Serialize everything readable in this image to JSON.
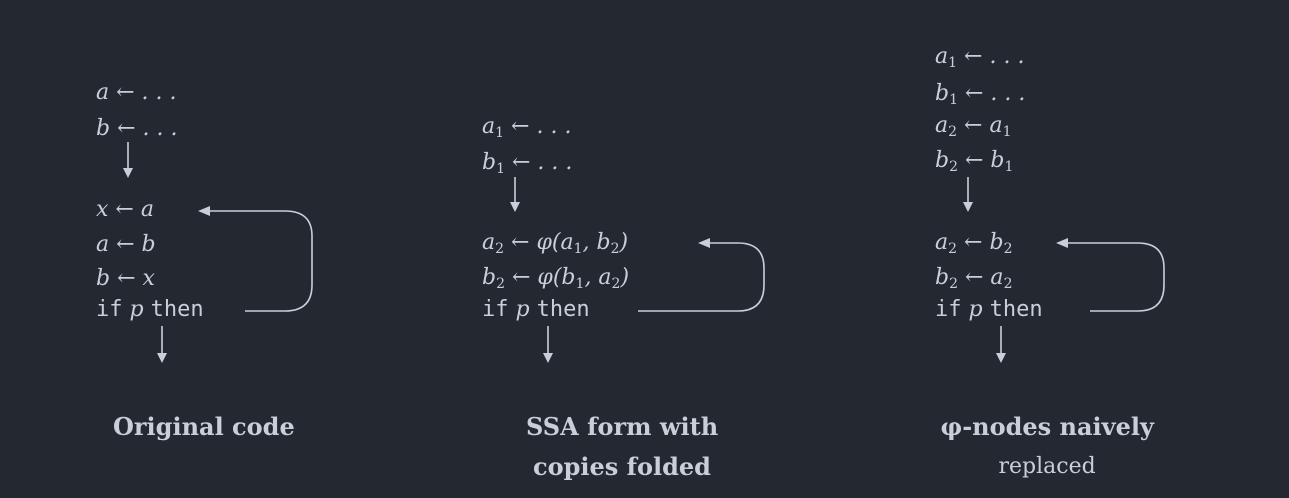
{
  "columns": [
    {
      "id": "original",
      "top_lines": [
        [
          {
            "t": "a ← . . ."
          }
        ],
        [
          {
            "t": "b ← . . ."
          }
        ]
      ],
      "loop_lines": [
        [
          {
            "t": "x ← a"
          }
        ],
        [
          {
            "t": "a ← b"
          }
        ],
        [
          {
            "t": "b ← x"
          }
        ],
        [
          {
            "t": "if",
            "kw": true
          },
          {
            "t": " p "
          },
          {
            "t": "then",
            "kw": true
          }
        ]
      ],
      "caption_lines": [
        "Original code"
      ],
      "caption_light": ""
    },
    {
      "id": "ssa",
      "top_lines": [
        [
          {
            "t": "a"
          },
          {
            "t": "1",
            "sub": true
          },
          {
            "t": " ← . . ."
          }
        ],
        [
          {
            "t": "b"
          },
          {
            "t": "1",
            "sub": true
          },
          {
            "t": " ← . . ."
          }
        ]
      ],
      "loop_lines": [
        [
          {
            "t": "a"
          },
          {
            "t": "2",
            "sub": true
          },
          {
            "t": " ← φ(a"
          },
          {
            "t": "1",
            "sub": true
          },
          {
            "t": ", b"
          },
          {
            "t": "2",
            "sub": true
          },
          {
            "t": ")"
          }
        ],
        [
          {
            "t": "b"
          },
          {
            "t": "2",
            "sub": true
          },
          {
            "t": " ← φ(b"
          },
          {
            "t": "1",
            "sub": true
          },
          {
            "t": ", a"
          },
          {
            "t": "2",
            "sub": true
          },
          {
            "t": ")"
          }
        ],
        [
          {
            "t": "if",
            "kw": true
          },
          {
            "t": " p "
          },
          {
            "t": "then",
            "kw": true
          }
        ]
      ],
      "caption_lines": [
        "SSA form with",
        "copies folded"
      ],
      "caption_light": ""
    },
    {
      "id": "naive",
      "top_lines": [
        [
          {
            "t": "a"
          },
          {
            "t": "1",
            "sub": true
          },
          {
            "t": " ← . . ."
          }
        ],
        [
          {
            "t": "b"
          },
          {
            "t": "1",
            "sub": true
          },
          {
            "t": " ← . . ."
          }
        ],
        [
          {
            "t": "a"
          },
          {
            "t": "2",
            "sub": true
          },
          {
            "t": " ← a"
          },
          {
            "t": "1",
            "sub": true
          }
        ],
        [
          {
            "t": "b"
          },
          {
            "t": "2",
            "sub": true
          },
          {
            "t": " ← b"
          },
          {
            "t": "1",
            "sub": true
          }
        ]
      ],
      "loop_lines": [
        [
          {
            "t": "a"
          },
          {
            "t": "2",
            "sub": true
          },
          {
            "t": " ← b"
          },
          {
            "t": "2",
            "sub": true
          }
        ],
        [
          {
            "t": "b"
          },
          {
            "t": "2",
            "sub": true
          },
          {
            "t": " ← a"
          },
          {
            "t": "2",
            "sub": true
          }
        ],
        [
          {
            "t": "if",
            "kw": true
          },
          {
            "t": " p "
          },
          {
            "t": "then",
            "kw": true
          }
        ]
      ],
      "caption_lines": [
        "φ-nodes naively"
      ],
      "caption_light": "replaced"
    }
  ]
}
